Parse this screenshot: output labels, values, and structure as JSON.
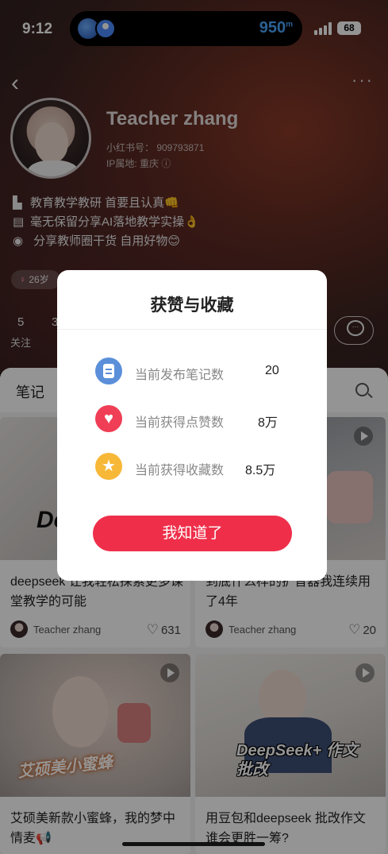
{
  "status": {
    "time": "9:12",
    "distance": "950",
    "distance_unit": "m",
    "battery": "68"
  },
  "profile": {
    "name": "Teacher zhang",
    "id_line": "小红书号： 909793871",
    "ip_line": "IP属地: 重庆",
    "bio": [
      {
        "icon": "book-icon",
        "text": "教育教学教研  首要且认真👊"
      },
      {
        "icon": "document-icon",
        "text": "毫无保留分享AI落地教学实操👌"
      },
      {
        "icon": "lightbulb-icon",
        "text": " 分享教师圈干货 自用好物😊"
      }
    ],
    "age_tag": "26岁",
    "stats": [
      {
        "num": "5",
        "label": "关注"
      },
      {
        "num": "3",
        "label": ""
      }
    ]
  },
  "feed": {
    "tab": "笔记",
    "cards": [
      {
        "title": "deepseek 让我轻松探索更多课堂教学的可能",
        "author": "Teacher zhang",
        "likes": "631",
        "overlay": "De 课"
      },
      {
        "title": "到底什么样的扩音器我连续用了4年",
        "author": "Teacher zhang",
        "likes": "20",
        "overlay": ""
      },
      {
        "title": "艾硕美新款小蜜蜂，我的梦中情麦📢",
        "author": "",
        "likes": "",
        "overlay": "艾硕美小蜜蜂"
      },
      {
        "title": "用豆包和deepseek 批改作文 谁会更胜一筹?",
        "author": "",
        "likes": "",
        "overlay": "DeepSeek+ 作文批改"
      }
    ]
  },
  "modal": {
    "title": "获赞与收藏",
    "rows": [
      {
        "icon": "note-icon",
        "label": "当前发布笔记数",
        "value": "20"
      },
      {
        "icon": "heart-icon",
        "label": "当前获得点赞数",
        "value": "8万"
      },
      {
        "icon": "star-icon",
        "label": "当前获得收藏数",
        "value": "8.5万"
      }
    ],
    "button": "我知道了"
  }
}
